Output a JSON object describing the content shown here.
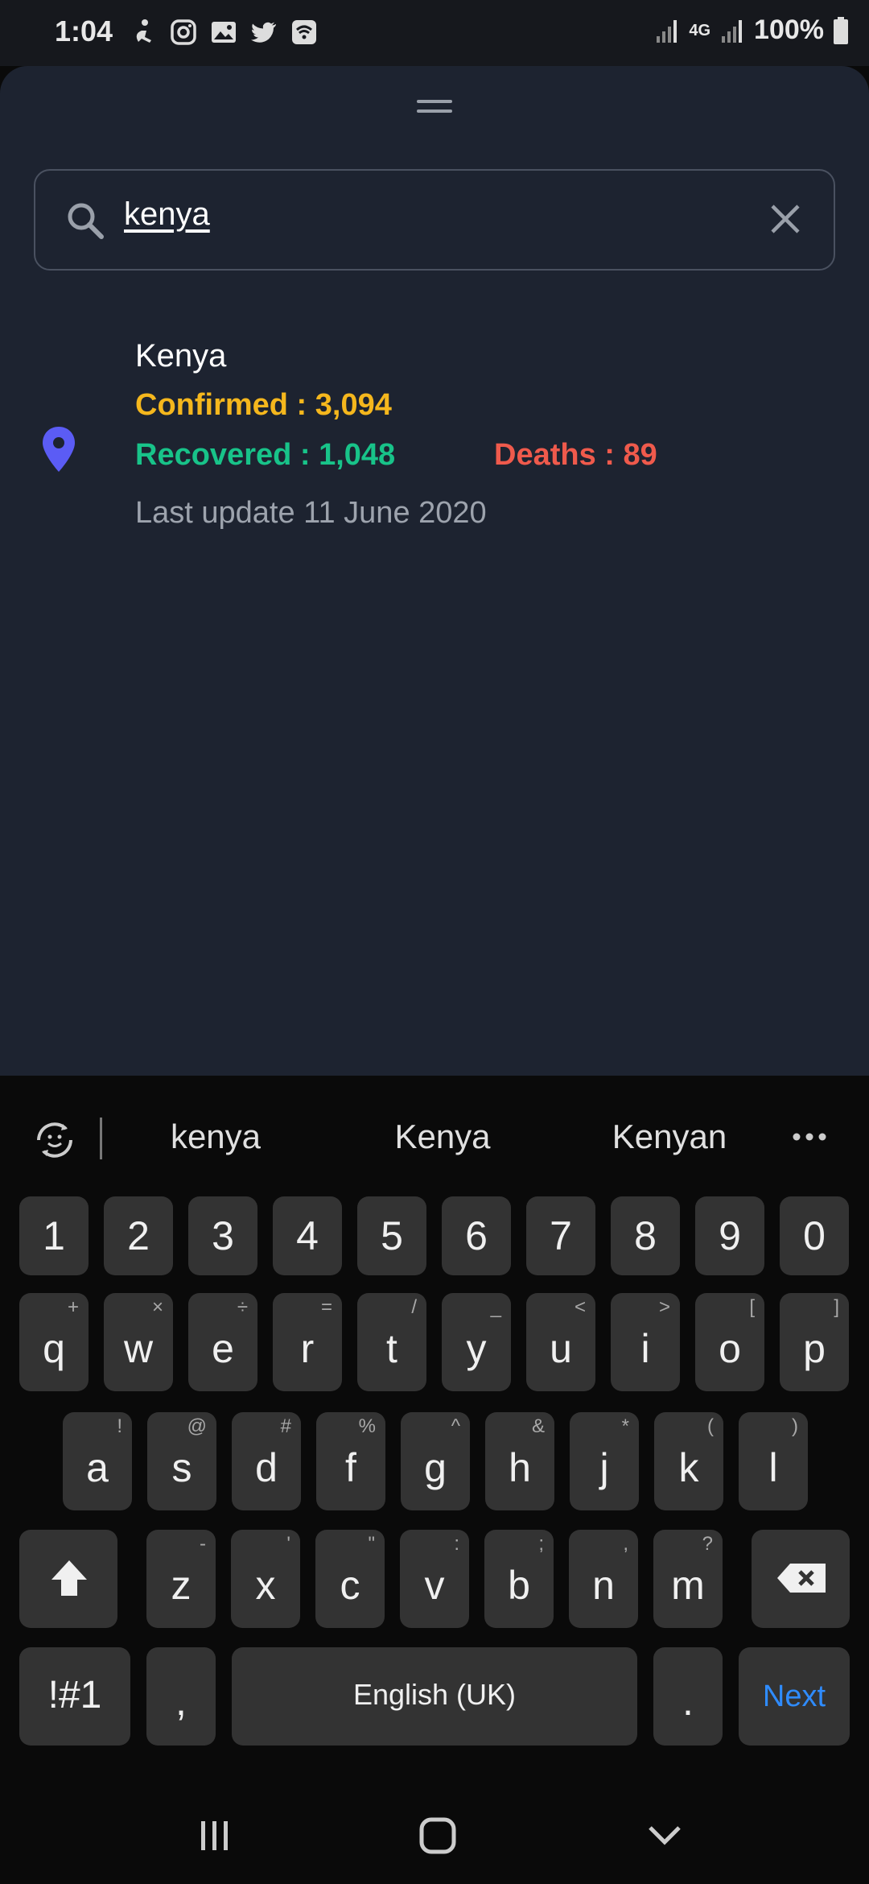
{
  "status_bar": {
    "time": "1:04",
    "network": "4G",
    "battery": "100%",
    "icons": [
      "accessibility-icon",
      "instagram-icon",
      "gallery-icon",
      "twitter-icon",
      "wifi-box-icon"
    ]
  },
  "search": {
    "value": "kenya"
  },
  "result": {
    "country": "Kenya",
    "confirmed": "Confirmed : 3,094",
    "recovered": "Recovered : 1,048",
    "deaths": "Deaths : 89",
    "last_update": "Last update 11 June 2020"
  },
  "colors": {
    "confirmed": "#f5b71d",
    "recovered": "#18c389",
    "deaths": "#ef5a4c",
    "pin": "#5b5cf5",
    "sheet_bg": "#1d2330"
  },
  "keyboard": {
    "suggestions": [
      "kenya",
      "Kenya",
      "Kenyan"
    ],
    "number_row": [
      "1",
      "2",
      "3",
      "4",
      "5",
      "6",
      "7",
      "8",
      "9",
      "0"
    ],
    "row1": [
      {
        "key": "q",
        "hint": "+"
      },
      {
        "key": "w",
        "hint": "×"
      },
      {
        "key": "e",
        "hint": "÷"
      },
      {
        "key": "r",
        "hint": "="
      },
      {
        "key": "t",
        "hint": "/"
      },
      {
        "key": "y",
        "hint": "_"
      },
      {
        "key": "u",
        "hint": "<"
      },
      {
        "key": "i",
        "hint": ">"
      },
      {
        "key": "o",
        "hint": "["
      },
      {
        "key": "p",
        "hint": "]"
      }
    ],
    "row2": [
      {
        "key": "a",
        "hint": "!"
      },
      {
        "key": "s",
        "hint": "@"
      },
      {
        "key": "d",
        "hint": "#"
      },
      {
        "key": "f",
        "hint": "%"
      },
      {
        "key": "g",
        "hint": "^"
      },
      {
        "key": "h",
        "hint": "&"
      },
      {
        "key": "j",
        "hint": "*"
      },
      {
        "key": "k",
        "hint": "("
      },
      {
        "key": "l",
        "hint": ")"
      }
    ],
    "row3": [
      {
        "key": "z",
        "hint": "-"
      },
      {
        "key": "x",
        "hint": "'"
      },
      {
        "key": "c",
        "hint": "\""
      },
      {
        "key": "v",
        "hint": ":"
      },
      {
        "key": "b",
        "hint": ";"
      },
      {
        "key": "n",
        "hint": ","
      },
      {
        "key": "m",
        "hint": "?"
      }
    ],
    "symbols_label": "!#1",
    "comma_label": ",",
    "space_label": "English (UK)",
    "period_label": ".",
    "next_label": "Next",
    "next_color": "#2f8cff"
  }
}
